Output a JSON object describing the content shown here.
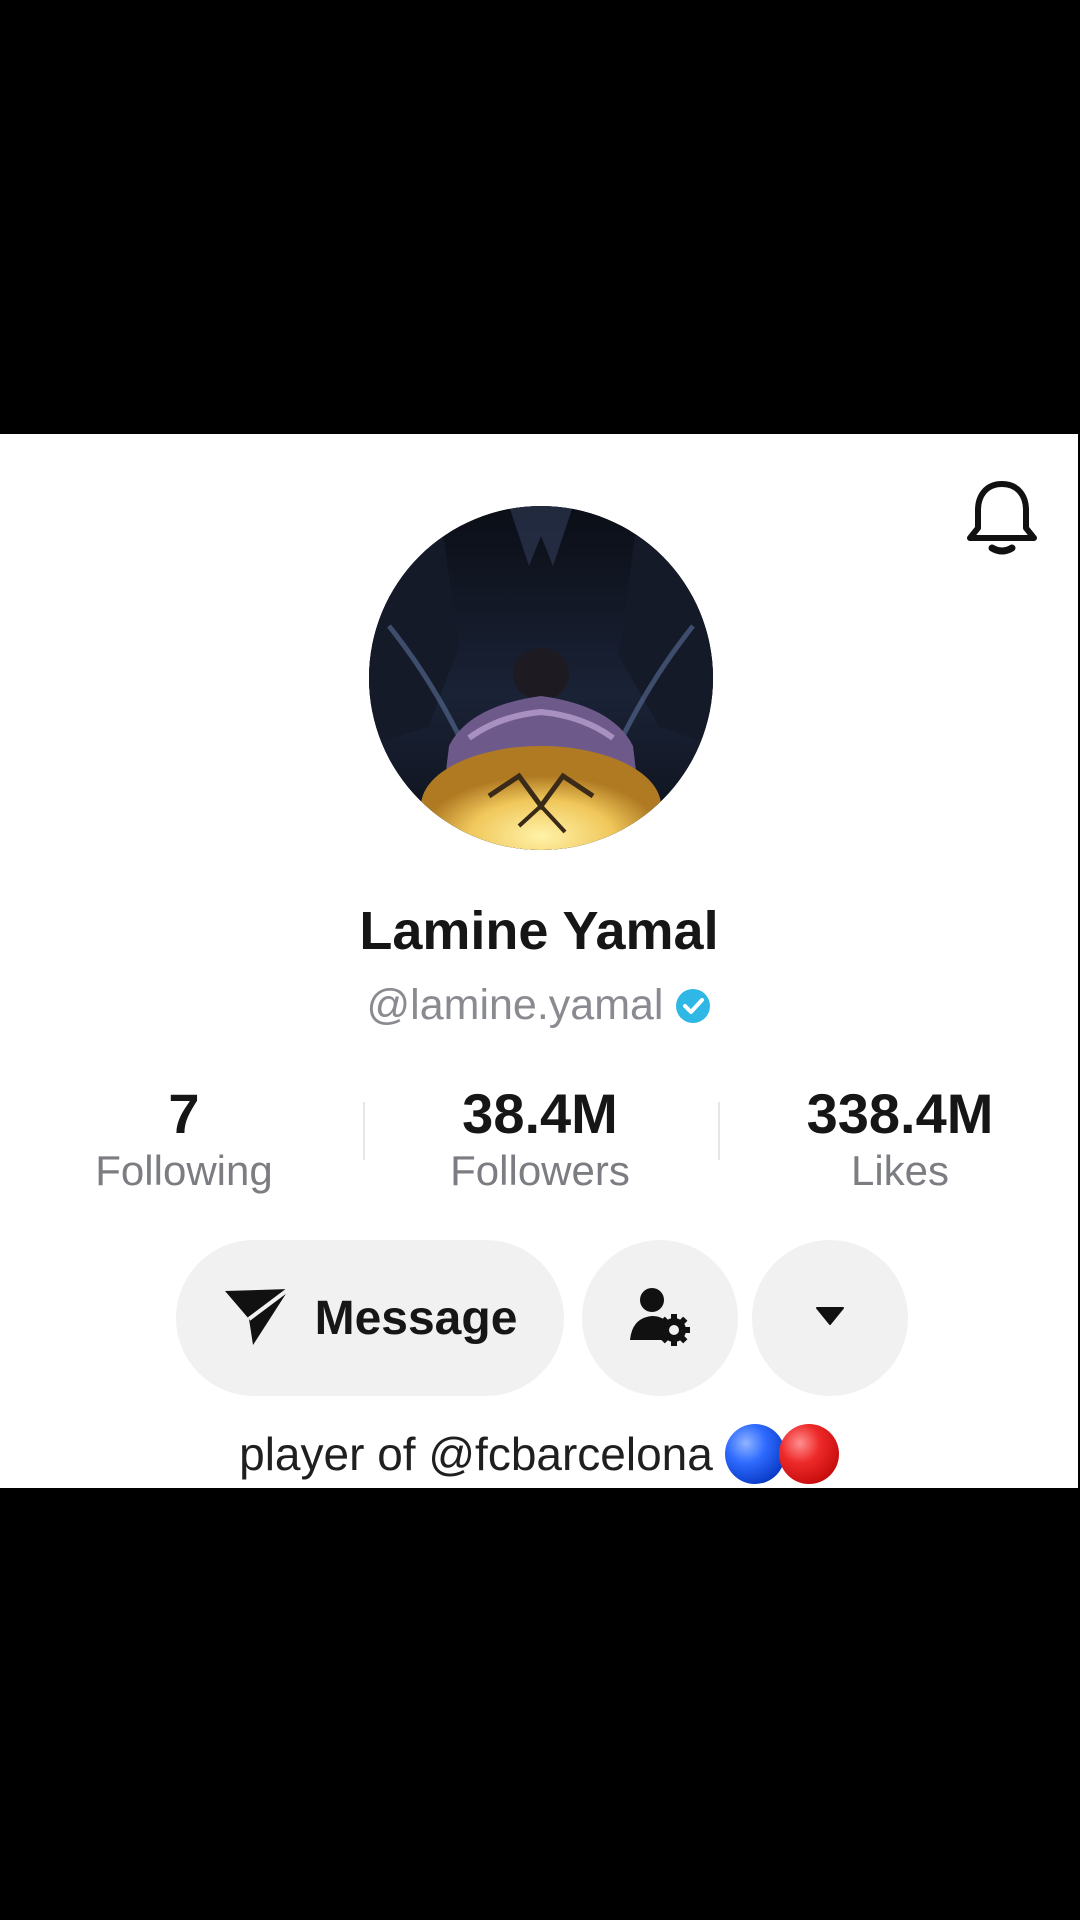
{
  "profile": {
    "display_name": "Lamine Yamal",
    "handle": "@lamine.yamal",
    "verified": true
  },
  "stats": [
    {
      "value": "7",
      "label": "Following"
    },
    {
      "value": "38.4M",
      "label": "Followers"
    },
    {
      "value": "338.4M",
      "label": "Likes"
    }
  ],
  "actions": {
    "message_label": "Message",
    "settings_icon": "person-gear-icon",
    "more_icon": "caret-down-icon"
  },
  "bio": {
    "text": "player of @fcbarcelona",
    "emoji_colors": [
      "#1f55e8",
      "#e01818"
    ]
  },
  "icons": {
    "notification": "bell-icon",
    "message": "paper-plane-icon",
    "verified": "verified-badge-icon"
  },
  "colors": {
    "verified_badge": "#2fb8e6",
    "button_bg": "#f1f1f2",
    "secondary_text": "#8a8b91"
  }
}
